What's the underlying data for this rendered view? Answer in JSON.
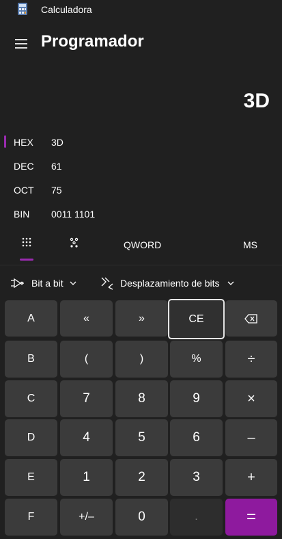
{
  "app": {
    "title": "Calculadora",
    "mode": "Programador"
  },
  "display": {
    "value": "3D"
  },
  "radix": [
    {
      "label": "HEX",
      "value": "3D",
      "selected": true
    },
    {
      "label": "DEC",
      "value": "61"
    },
    {
      "label": "OCT",
      "value": "75"
    },
    {
      "label": "BIN",
      "value": "0011 1101"
    }
  ],
  "tabs": {
    "keypad_icon": "keypad-icon",
    "bit_toggle_icon": "bit-toggle-icon",
    "word_size": "QWORD",
    "memory": "MS"
  },
  "toolbar": {
    "bitwise": "Bit a bit",
    "bitshift": "Desplazamiento de bits"
  },
  "keys": {
    "row1": [
      "A",
      "«",
      "»",
      "CE",
      "backspace"
    ],
    "row2": [
      "B",
      "(",
      ")",
      "%",
      "÷"
    ],
    "row3": [
      "C",
      "7",
      "8",
      "9",
      "×"
    ],
    "row4": [
      "D",
      "4",
      "5",
      "6",
      "–"
    ],
    "row5": [
      "E",
      "1",
      "2",
      "3",
      "+"
    ],
    "row6": [
      "F",
      "+/–",
      "0",
      ".",
      "="
    ]
  },
  "colors": {
    "accent": "#8e1a9e",
    "background": "#202020",
    "key": "#3b3b3b"
  }
}
